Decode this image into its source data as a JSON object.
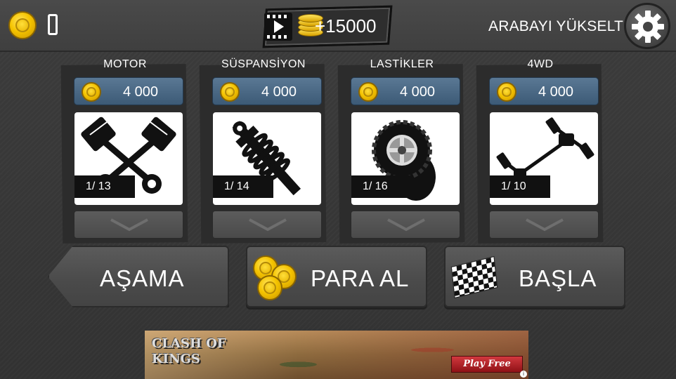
{
  "top_bar": {
    "reward_amount": "+15000",
    "upgrade_title": "ARABAYI YÜKSELT"
  },
  "upgrades": [
    {
      "label": "MOTOR",
      "price": "4 000",
      "level": "1/ 13",
      "icon": "piston-icon"
    },
    {
      "label": "SÜSPANSİYON",
      "price": "4 000",
      "level": "1/ 14",
      "icon": "shock-absorber-icon"
    },
    {
      "label": "LASTİKLER",
      "price": "4 000",
      "level": "1/ 16",
      "icon": "tire-icon"
    },
    {
      "label": "4WD",
      "price": "4 000",
      "level": "1/ 10",
      "icon": "drivetrain-icon"
    }
  ],
  "buttons": {
    "stage": "AŞAMA",
    "get_coins": "PARA AL",
    "start": "BAŞLA"
  },
  "ad": {
    "title": "CLASH OF KINGS",
    "cta": "Play Free"
  },
  "colors": {
    "price_bg": "#4a6a88",
    "coin": "#f5c400",
    "panel": "#3a3a3a"
  }
}
